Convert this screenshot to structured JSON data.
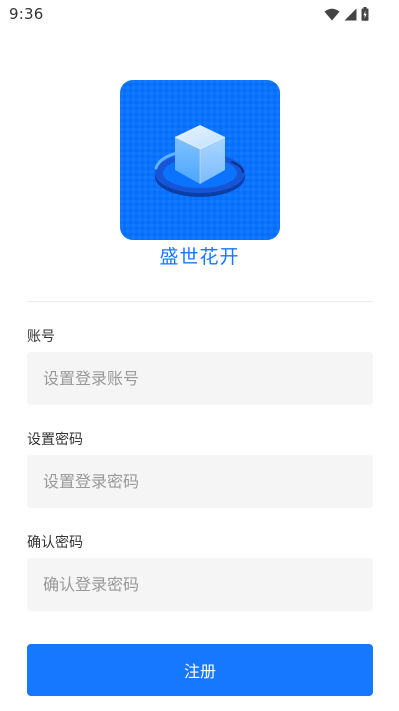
{
  "status_bar": {
    "time": "9:36",
    "icons": [
      "wifi-icon",
      "cellular-signal-icon",
      "battery-charging-icon"
    ]
  },
  "app": {
    "logo_icon": "cube-logo-icon",
    "name": "盛世花开"
  },
  "form": {
    "account": {
      "label": "账号",
      "placeholder": "设置登录账号",
      "value": ""
    },
    "password": {
      "label": "设置密码",
      "placeholder": "设置登录密码",
      "value": ""
    },
    "confirm_password": {
      "label": "确认密码",
      "placeholder": "确认登录密码",
      "value": ""
    },
    "submit_label": "注册"
  },
  "colors": {
    "accent": "#1677ff",
    "logo_background": "#0a73ff",
    "input_background": "#f5f5f5",
    "placeholder_text": "#999999"
  }
}
